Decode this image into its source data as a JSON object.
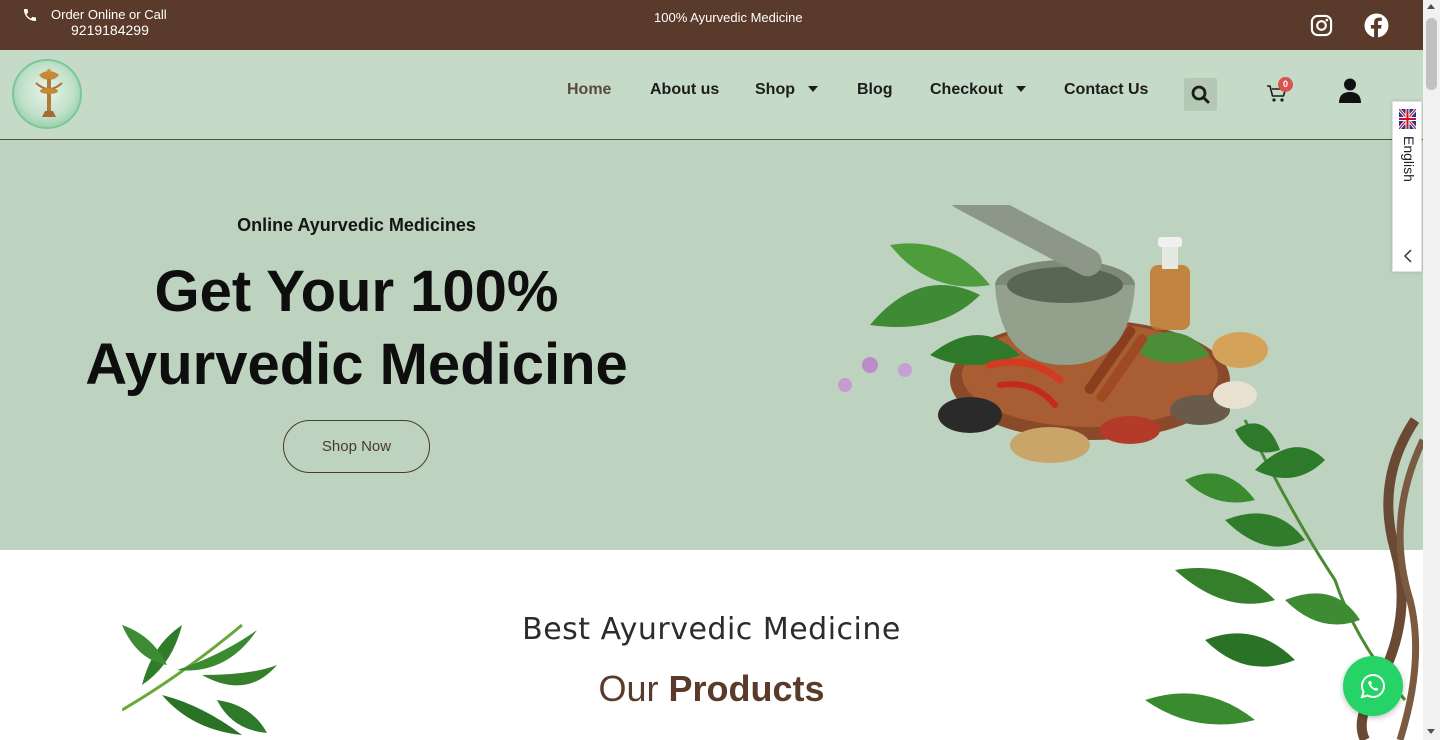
{
  "topbar": {
    "order_label": "Order Online or Call",
    "phone": "9219184299",
    "tagline": "100% Ayurvedic Medicine",
    "icons": [
      "phone-icon",
      "instagram-icon",
      "facebook-icon"
    ]
  },
  "nav": {
    "items": [
      {
        "label": "Home",
        "active": true
      },
      {
        "label": "About us"
      },
      {
        "label": "Shop",
        "dropdown": true
      },
      {
        "label": "Blog"
      },
      {
        "label": "Checkout",
        "dropdown": true
      },
      {
        "label": "Contact Us"
      }
    ],
    "cart_count": "0",
    "icons": [
      "search-icon",
      "cart-icon",
      "user-icon"
    ]
  },
  "hero": {
    "subtitle": "Online Ayurvedic Medicines",
    "title_line1": "Get Your 100%",
    "title_line2": "Ayurvedic Medicine",
    "button": "Shop Now"
  },
  "section": {
    "title": "Best Ayurvedic Medicine",
    "subtitle_light": "Our",
    "subtitle_bold": "Products"
  },
  "language": {
    "label": "English"
  },
  "colors": {
    "topbar_bg": "#5a3a2a",
    "nav_bg": "#c5dbc7",
    "hero_bg": "#bdd3bf",
    "accent_brown": "#5a3a2a",
    "whatsapp_green": "#25d366"
  }
}
